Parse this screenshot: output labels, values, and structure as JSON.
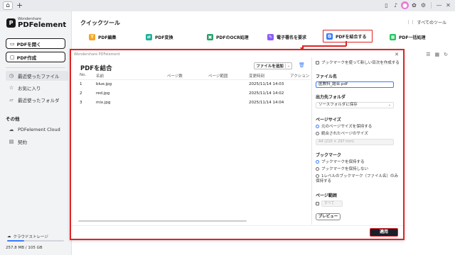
{
  "titlebar": {
    "home_icon": "home-icon",
    "new_tab": "+",
    "icons": [
      "phone-icon",
      "bell-icon",
      "avatar-icon",
      "gift-icon",
      "settings-icon",
      "minimize-icon",
      "close-icon"
    ]
  },
  "sidebar": {
    "brand_small": "Wondershare",
    "brand": "PDFelement",
    "open_pdf": "PDFを開く",
    "create_pdf": "PDF作成",
    "items": [
      {
        "label": "最近使ったファイル",
        "icon": "clock-icon"
      },
      {
        "label": "お気に入り",
        "icon": "star-icon"
      },
      {
        "label": "最近使ったフォルダ",
        "icon": "folder-icon"
      }
    ],
    "other_label": "その他",
    "other_items": [
      {
        "label": "PDFelement Cloud",
        "icon": "cloud-icon"
      },
      {
        "label": "契約",
        "icon": "document-icon"
      }
    ],
    "storage_label": "クラウドストレージ",
    "storage_text": "257.8 MB / 105 GB",
    "storage_fraction": 0.3
  },
  "main": {
    "quick_tools_title": "クイックツール",
    "all_tools": "すべてのツール",
    "tools": [
      {
        "label": "PDF編集",
        "color": "#f5a623"
      },
      {
        "label": "PDF変換",
        "color": "#1bb29a"
      },
      {
        "label": "PDFのOCR処理",
        "color": "#27a167"
      },
      {
        "label": "電子署名を要求",
        "color": "#8b5cf6"
      },
      {
        "label": "PDFを結合する",
        "color": "#3b7bff"
      },
      {
        "label": "PDF一括処理",
        "color": "#22c55e"
      }
    ]
  },
  "dialog": {
    "caption": "Wondershare PDFelement",
    "title": "PDFを結合",
    "add_file": "ファイルを追加",
    "columns": [
      "No.",
      "名前",
      "ページ数",
      "ページ範囲",
      "変更時刻",
      "アクション"
    ],
    "rows": [
      {
        "no": "1",
        "name": "blue.jpg",
        "date": "2025/11/14 14:03"
      },
      {
        "no": "2",
        "name": "red.jpg",
        "date": "2025/11/14 14:02"
      },
      {
        "no": "3",
        "name": "mix.jpg",
        "date": "2025/11/14 14:04"
      }
    ],
    "bookmark_toc": "ブックマークを使って新しい目次を作成する",
    "filename_label": "ファイル名",
    "filename_value": "医教科_結合.pdf",
    "output_folder_label": "出力先フォルダ",
    "output_folder_value": "ソースフォルダに保存",
    "page_size_label": "ページサイズ",
    "page_size_opt1": "元のページサイズを保持する",
    "page_size_opt2": "統合されたページのサイズ",
    "page_size_placeholder": "A4 (210 × 297 mm)",
    "bookmark_label": "ブックマーク",
    "bookmark_opt1": "ブックマークを保持する",
    "bookmark_opt2": "ブックマークを保持しない",
    "bookmark_opt3": "1レベルのブックマーク（ファイル名）のみ保持する",
    "page_label_label": "ページ範囲",
    "page_label_placeholder": "すべて",
    "preview": "プレビュー",
    "apply": "適用"
  }
}
